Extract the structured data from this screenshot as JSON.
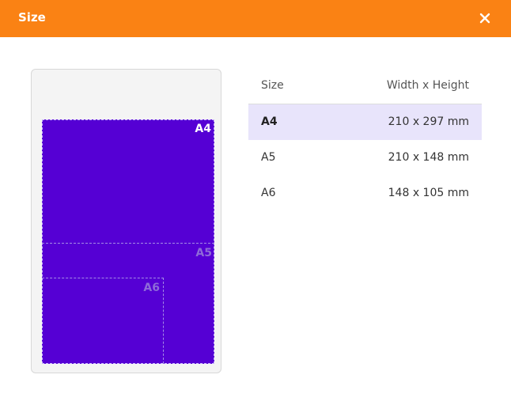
{
  "dialog": {
    "title": "Size",
    "accent_color": "#fa8214",
    "close_icon": "close-icon"
  },
  "preview": {
    "paper_color": "#5500d4",
    "labels": {
      "a4": "A4",
      "a5": "A5",
      "a6": "A6"
    }
  },
  "table": {
    "headers": {
      "size": "Size",
      "dimensions": "Width x Height"
    },
    "selected_color": "#e8e4fb",
    "rows": [
      {
        "size": "A4",
        "dimensions": "210 x 297 mm",
        "selected": true
      },
      {
        "size": "A5",
        "dimensions": "210 x 148 mm",
        "selected": false
      },
      {
        "size": "A6",
        "dimensions": "148 x 105 mm",
        "selected": false
      }
    ]
  }
}
